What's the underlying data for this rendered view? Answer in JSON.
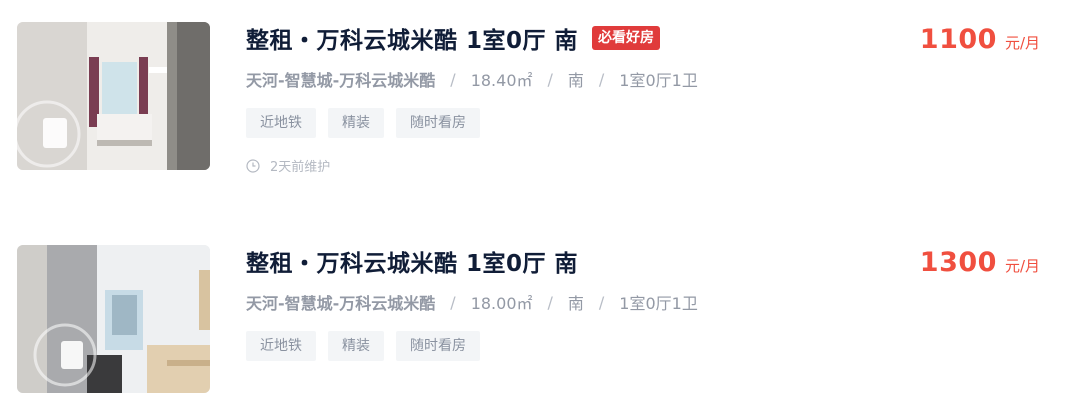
{
  "listings": [
    {
      "title": "整租・万科云城米酷 1室0厅 南",
      "badge": "必看好房",
      "location": "天河-智慧城-万科云城米酷",
      "area": "18.40㎡",
      "orientation": "南",
      "layout": "1室0厅1卫",
      "tags": [
        "近地铁",
        "精装",
        "随时看房"
      ],
      "maintenance": "2天前维护",
      "price": "1100",
      "price_unit": "元/月",
      "thumbnail_icon": "vr-panorama-icon"
    },
    {
      "title": "整租・万科云城米酷 1室0厅 南",
      "location": "天河-智慧城-万科云城米酷",
      "area": "18.00㎡",
      "orientation": "南",
      "layout": "1室0厅1卫",
      "tags": [
        "近地铁",
        "精装",
        "随时看房"
      ],
      "price": "1300",
      "price_unit": "元/月",
      "thumbnail_icon": "vr-panorama-icon"
    }
  ],
  "separator": "/",
  "colors": {
    "price": "#f04f3f",
    "badge": "#e03b3b",
    "title": "#101d37",
    "meta": "#9399a5"
  }
}
